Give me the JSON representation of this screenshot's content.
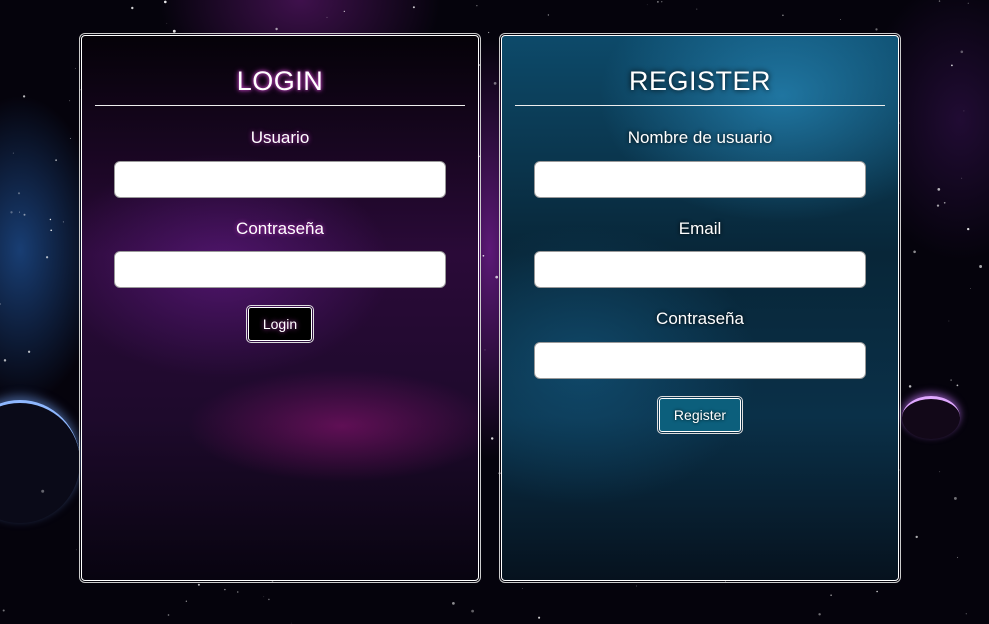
{
  "login": {
    "title": "LOGIN",
    "username_label": "Usuario",
    "username_value": "",
    "password_label": "Contraseña",
    "password_value": "",
    "submit_label": "Login"
  },
  "register": {
    "title": "REGISTER",
    "username_label": "Nombre de usuario",
    "username_value": "",
    "email_label": "Email",
    "email_value": "",
    "password_label": "Contraseña",
    "password_value": "",
    "submit_label": "Register"
  },
  "colors": {
    "register_button": "#0c5f7c",
    "login_button": "#000000",
    "login_glow": "#c040c0"
  }
}
